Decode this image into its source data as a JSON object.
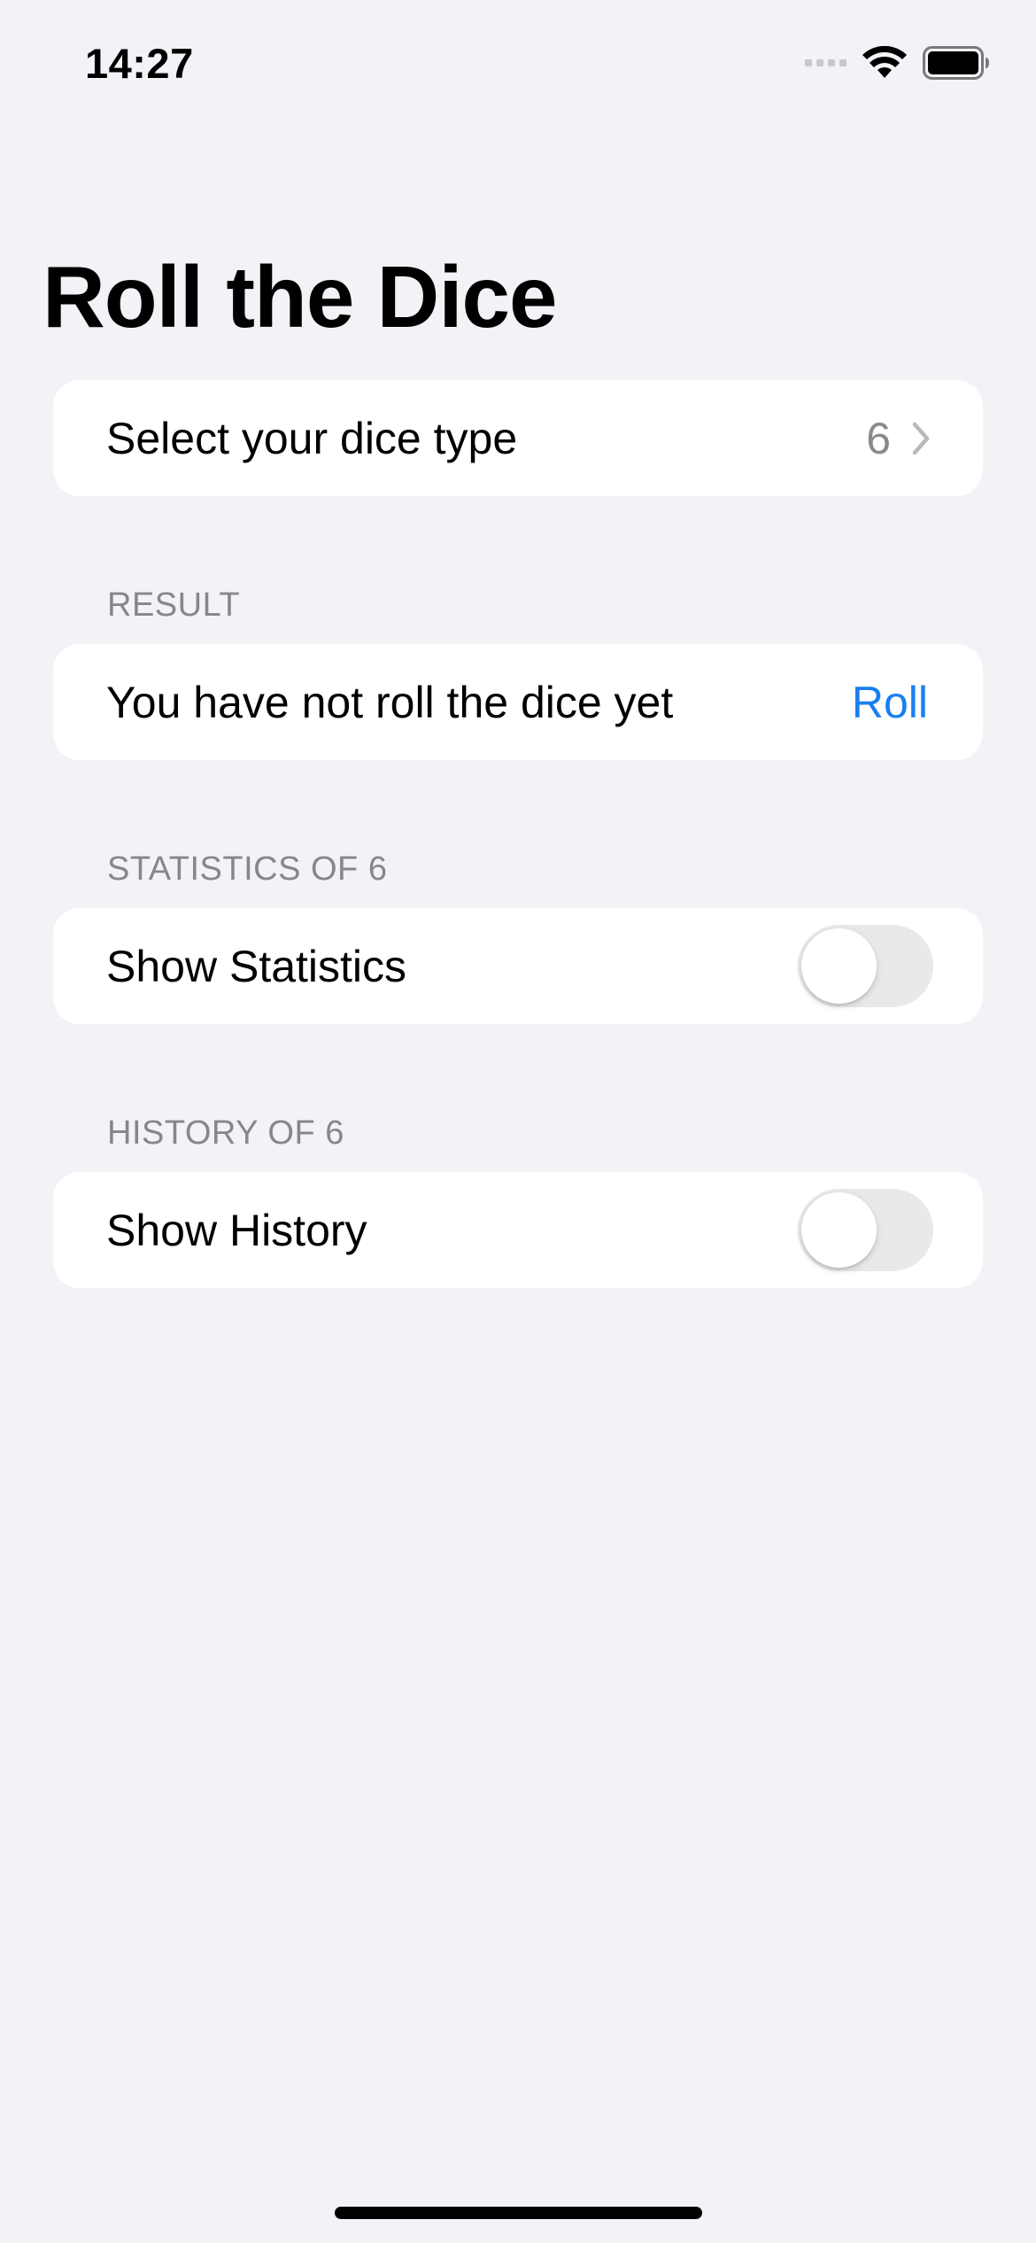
{
  "status_bar": {
    "time": "14:27",
    "icons": [
      "signal-icon",
      "wifi-icon",
      "battery-icon"
    ]
  },
  "title": "Roll the Dice",
  "dice_type": {
    "label": "Select your dice type",
    "value": "6",
    "icon": "chevron-right-icon"
  },
  "result": {
    "header": "RESULT",
    "text": "You have not roll the dice yet",
    "button_label": "Roll"
  },
  "statistics": {
    "header": "STATISTICS OF 6",
    "toggle_label": "Show Statistics",
    "toggle_on": false
  },
  "history": {
    "header": "HISTORY OF 6",
    "toggle_label": "Show History",
    "toggle_on": false
  },
  "colors": {
    "background": "#f2f2f7",
    "accent": "#1a7ff0",
    "secondary_text": "#86868b"
  }
}
